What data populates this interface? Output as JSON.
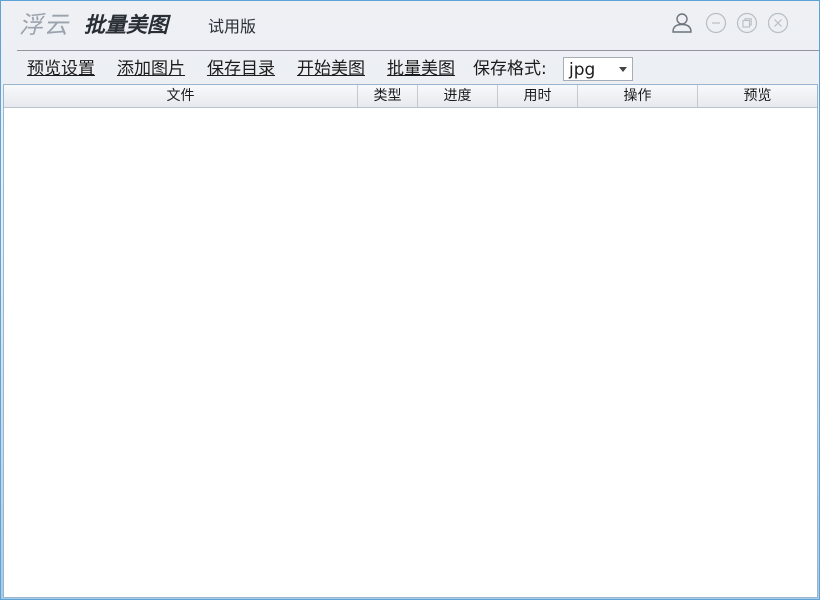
{
  "titlebar": {
    "logo": "浮云",
    "product": "批量美图",
    "edition": "试用版"
  },
  "window_controls": {
    "user": "user-icon",
    "minimize": "minimize-icon",
    "restore": "restore-icon",
    "close": "close-icon"
  },
  "toolbar": {
    "items": [
      "预览设置",
      "添加图片",
      "保存目录",
      "开始美图",
      "批量美图"
    ],
    "format_label": "保存格式:",
    "format_value": "jpg"
  },
  "table": {
    "columns": [
      "文件",
      "类型",
      "进度",
      "用时",
      "操作",
      "预览"
    ],
    "rows": []
  },
  "colors": {
    "window_border": "#5ea3d6",
    "background_top": "#eef0f4",
    "background_bottom": "#a9cbe6",
    "text": "#1c1c1c",
    "logo": "#9aa3ad"
  }
}
